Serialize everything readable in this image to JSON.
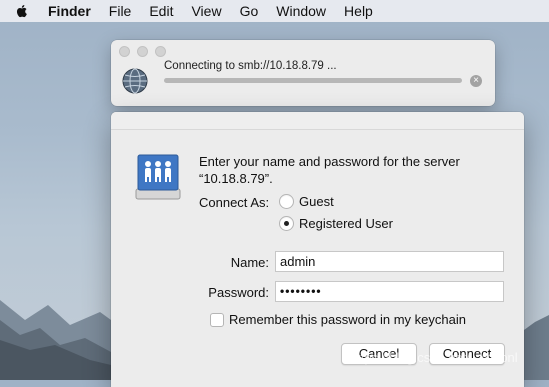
{
  "menubar": {
    "apple_icon": "apple-icon",
    "items": [
      "Finder",
      "File",
      "Edit",
      "View",
      "Go",
      "Window",
      "Help"
    ]
  },
  "connecting": {
    "message": "Connecting to smb://10.18.8.79 ...",
    "progress": 1.0,
    "cancel_icon": "close-circle-icon"
  },
  "login": {
    "prompt": "Enter your name and password for the server “10.18.8.79”.",
    "connect_as_label": "Connect As:",
    "options": [
      "Guest",
      "Registered User"
    ],
    "selected_option": "Registered User",
    "name_label": "Name:",
    "name_value": "admin",
    "password_label": "Password:",
    "password_value": "••••••••",
    "remember_label": "Remember this password in my keychain",
    "remember_checked": false,
    "cancel_label": "Cancel",
    "connect_label": "Connect"
  },
  "watermark": "https://blog.csdn.net/.../Koonl",
  "colors": {
    "window_bg": "#ececec",
    "desktop_sky": "#a9bbcd",
    "text": "#111111"
  }
}
